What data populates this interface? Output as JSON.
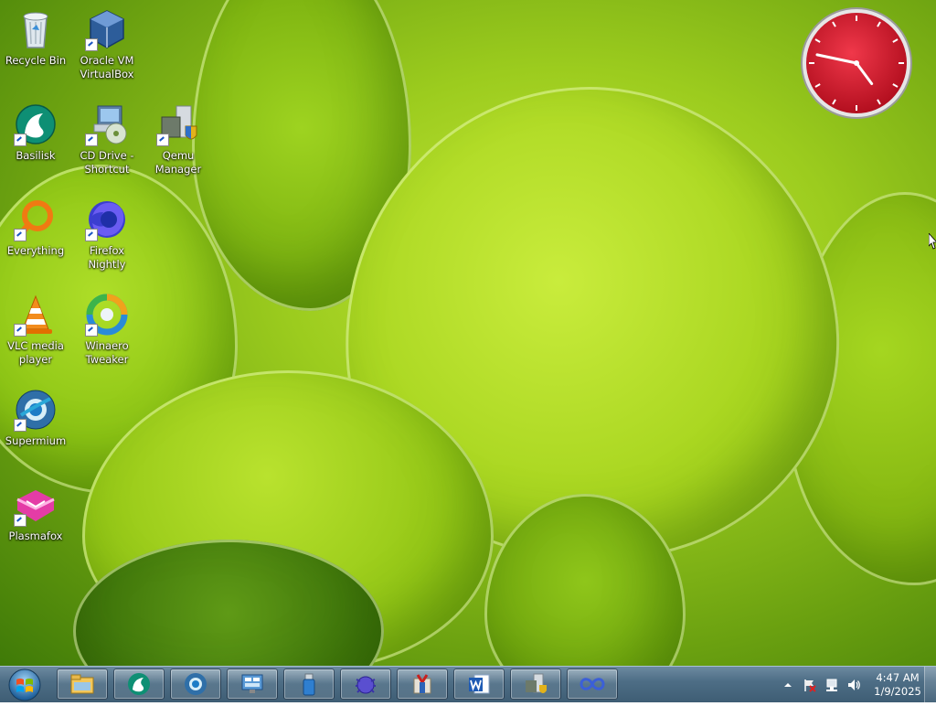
{
  "desktop": {
    "icons": [
      {
        "label": "Recycle Bin",
        "icon": "recycle-bin-icon"
      },
      {
        "label": "Oracle VM VirtualBox",
        "icon": "virtualbox-icon"
      },
      {
        "label": "Basilisk",
        "icon": "basilisk-icon"
      },
      {
        "label": "CD Drive - Shortcut",
        "icon": "cd-drive-icon"
      },
      {
        "label": "Qemu Manager",
        "icon": "qemu-manager-icon"
      },
      {
        "label": "Everything",
        "icon": "everything-search-icon"
      },
      {
        "label": "Firefox Nightly",
        "icon": "firefox-nightly-icon"
      },
      {
        "label": "VLC media player",
        "icon": "vlc-icon"
      },
      {
        "label": "Winaero Tweaker",
        "icon": "winaero-tweaker-icon"
      },
      {
        "label": "Supermium",
        "icon": "supermium-icon"
      },
      {
        "label": "Plasmafox",
        "icon": "plasmafox-icon"
      }
    ]
  },
  "clock_gadget": {
    "hour": 4,
    "minute": 47,
    "face_color": "#d8192a"
  },
  "taskbar": {
    "start_icon": "windows-start-orb-icon",
    "pinned": [
      {
        "icon": "file-explorer-icon"
      },
      {
        "icon": "basilisk-icon"
      },
      {
        "icon": "supermium-icon"
      },
      {
        "icon": "control-panel-icon"
      },
      {
        "icon": "usb-drive-icon"
      },
      {
        "icon": "bug-icon"
      },
      {
        "icon": "package-icon"
      },
      {
        "icon": "word-icon"
      },
      {
        "icon": "qemu-manager-icon"
      },
      {
        "icon": "infinity-icon"
      }
    ],
    "tray": {
      "icons": [
        "show-hidden-icons-arrow-icon",
        "action-center-flag-icon",
        "network-icon",
        "volume-icon"
      ],
      "time": "4:47 AM",
      "date": "1/9/2025"
    }
  },
  "colors": {
    "taskbar": "#4e6e86",
    "wallpaper_accent": "#a6d41e",
    "clock_red": "#d8192a"
  }
}
